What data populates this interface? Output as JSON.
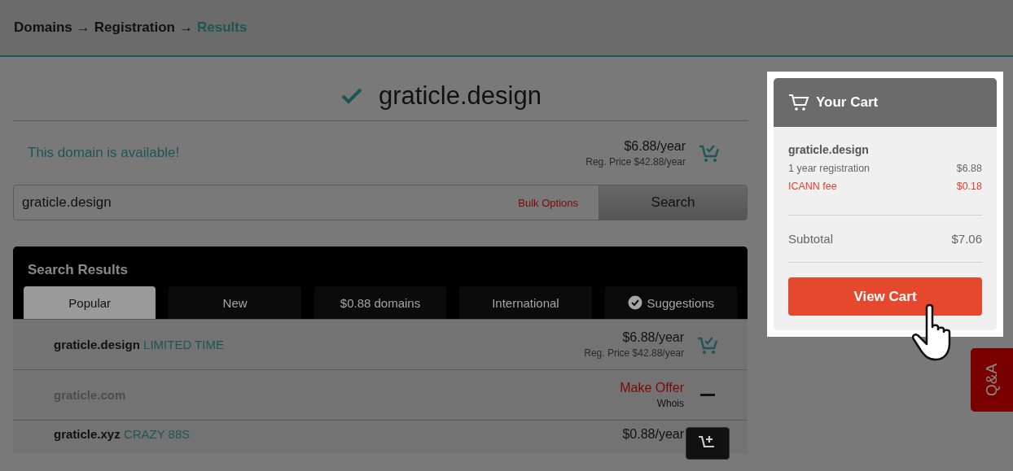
{
  "breadcrumb": [
    {
      "label": "Domains",
      "current": false
    },
    {
      "separator": "→",
      "label": "Registration",
      "current": false
    },
    {
      "separator": "→",
      "label": "Results",
      "current": true
    }
  ],
  "domain_header": {
    "name": "graticle.design",
    "available": true
  },
  "availability": {
    "message": "This domain is available!",
    "price": "$6.88/year",
    "reg_price": "Reg. Price $42.88/year",
    "in_cart": true
  },
  "search": {
    "value": "graticle.design",
    "bulk_options": "Bulk Options",
    "button": "Search"
  },
  "results": {
    "title": "Search Results",
    "tabs": [
      {
        "label": "Popular",
        "selected": true,
        "kind": "plain"
      },
      {
        "label": "New",
        "selected": false,
        "kind": "plain"
      },
      {
        "label": "$0.88 domains",
        "selected": false,
        "kind": "plain"
      },
      {
        "label": "International",
        "selected": false,
        "kind": "plain"
      },
      {
        "label": "Suggestions",
        "selected": false,
        "kind": "checked"
      }
    ],
    "rows": [
      {
        "domain": "graticle.design",
        "tag": "LIMITED TIME",
        "kind": "in_cart",
        "price": "$6.88/year",
        "reg_price": "Reg. Price $42.88/year"
      },
      {
        "domain": "graticle.com",
        "kind": "taken",
        "offer": "Make Offer",
        "whois": "Whois"
      },
      {
        "domain": "graticle.xyz",
        "tag": "CRAZY 88S",
        "kind": "add",
        "price": "$0.88/year"
      }
    ]
  },
  "cart": {
    "title": "Your Cart",
    "items": [
      {
        "name": "graticle.design",
        "lines": [
          {
            "label": "1 year registration",
            "amount": "$6.88",
            "kind": "item"
          },
          {
            "label": "ICANN fee",
            "amount": "$0.18",
            "kind": "fee"
          }
        ]
      }
    ],
    "subtotal": {
      "label": "Subtotal",
      "amount": "$7.06"
    },
    "button": "View Cart"
  },
  "qa_tab": "Q&A"
}
